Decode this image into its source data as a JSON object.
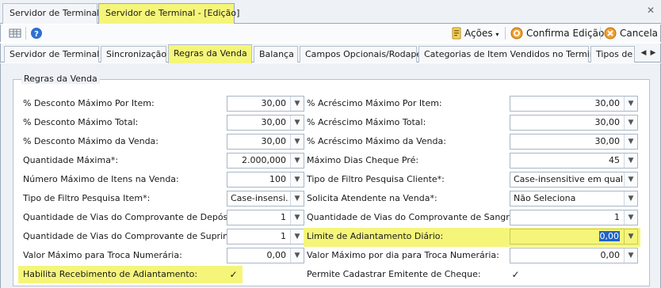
{
  "doc_tabs": {
    "tab1": "Servidor de Terminal",
    "tab2": "Servidor de Terminal - [Edição]",
    "close": "✕"
  },
  "toolbar": {
    "acoes": "Ações",
    "confirmar": "Confirma Edição",
    "cancelar": "Cancela"
  },
  "page_tabs": [
    "Servidor de Terminal",
    "Sincronização",
    "Regras da Venda",
    "Balança",
    "Campos Opcionais/Rodapé",
    "Categorias de Item Vendidos no Terminal",
    "Tipos de"
  ],
  "group_title": "Regras da Venda",
  "left": [
    {
      "label": "% Desconto Máximo Por Item:",
      "value": "30,00"
    },
    {
      "label": "% Desconto Máximo Total:",
      "value": "30,00"
    },
    {
      "label": "% Desconto Máximo da Venda:",
      "value": "30,00"
    },
    {
      "label": "Quantidade Máxima*:",
      "value": "2.000,000"
    },
    {
      "label": "Número Máximo de Itens na Venda:",
      "value": "100"
    },
    {
      "label": "Tipo de Filtro Pesquisa Item*:",
      "value": "Case-insensi..."
    },
    {
      "label": "Quantidade de Vias do Comprovante de Depósito:",
      "value": "1"
    },
    {
      "label": "Quantidade de Vias do Comprovante de Suprimento:",
      "value": "1"
    },
    {
      "label": "Valor Máximo para Troca Numerária:",
      "value": "0,00"
    },
    {
      "label": "Habilita Recebimento de Adiantamento:",
      "value": "✓"
    }
  ],
  "right": [
    {
      "label": "% Acréscimo Máximo Por Item:",
      "value": "30,00"
    },
    {
      "label": "% Acréscimo Máximo Total:",
      "value": "30,00"
    },
    {
      "label": "% Acréscimo Máximo da Venda:",
      "value": "30,00"
    },
    {
      "label": "Máximo Dias Cheque Pré:",
      "value": "45"
    },
    {
      "label": "Tipo de Filtro Pesquisa Cliente*:",
      "value": "Case-insensitive em qualq..."
    },
    {
      "label": "Solicita Atendente na Venda*:",
      "value": "Não Seleciona"
    },
    {
      "label": "Quantidade de Vias do Comprovante de Sangria:",
      "value": "1"
    },
    {
      "label": "Limite de Adiantamento Diário:",
      "value": "0,00"
    },
    {
      "label": "Valor Máximo por dia para Troca Numerária:",
      "value": "0,00"
    },
    {
      "label": "Permite Cadastrar Emitente de Cheque:",
      "value": "✓"
    }
  ],
  "highlight_color": "#f5f57a",
  "selection_color": "#1f62c8"
}
